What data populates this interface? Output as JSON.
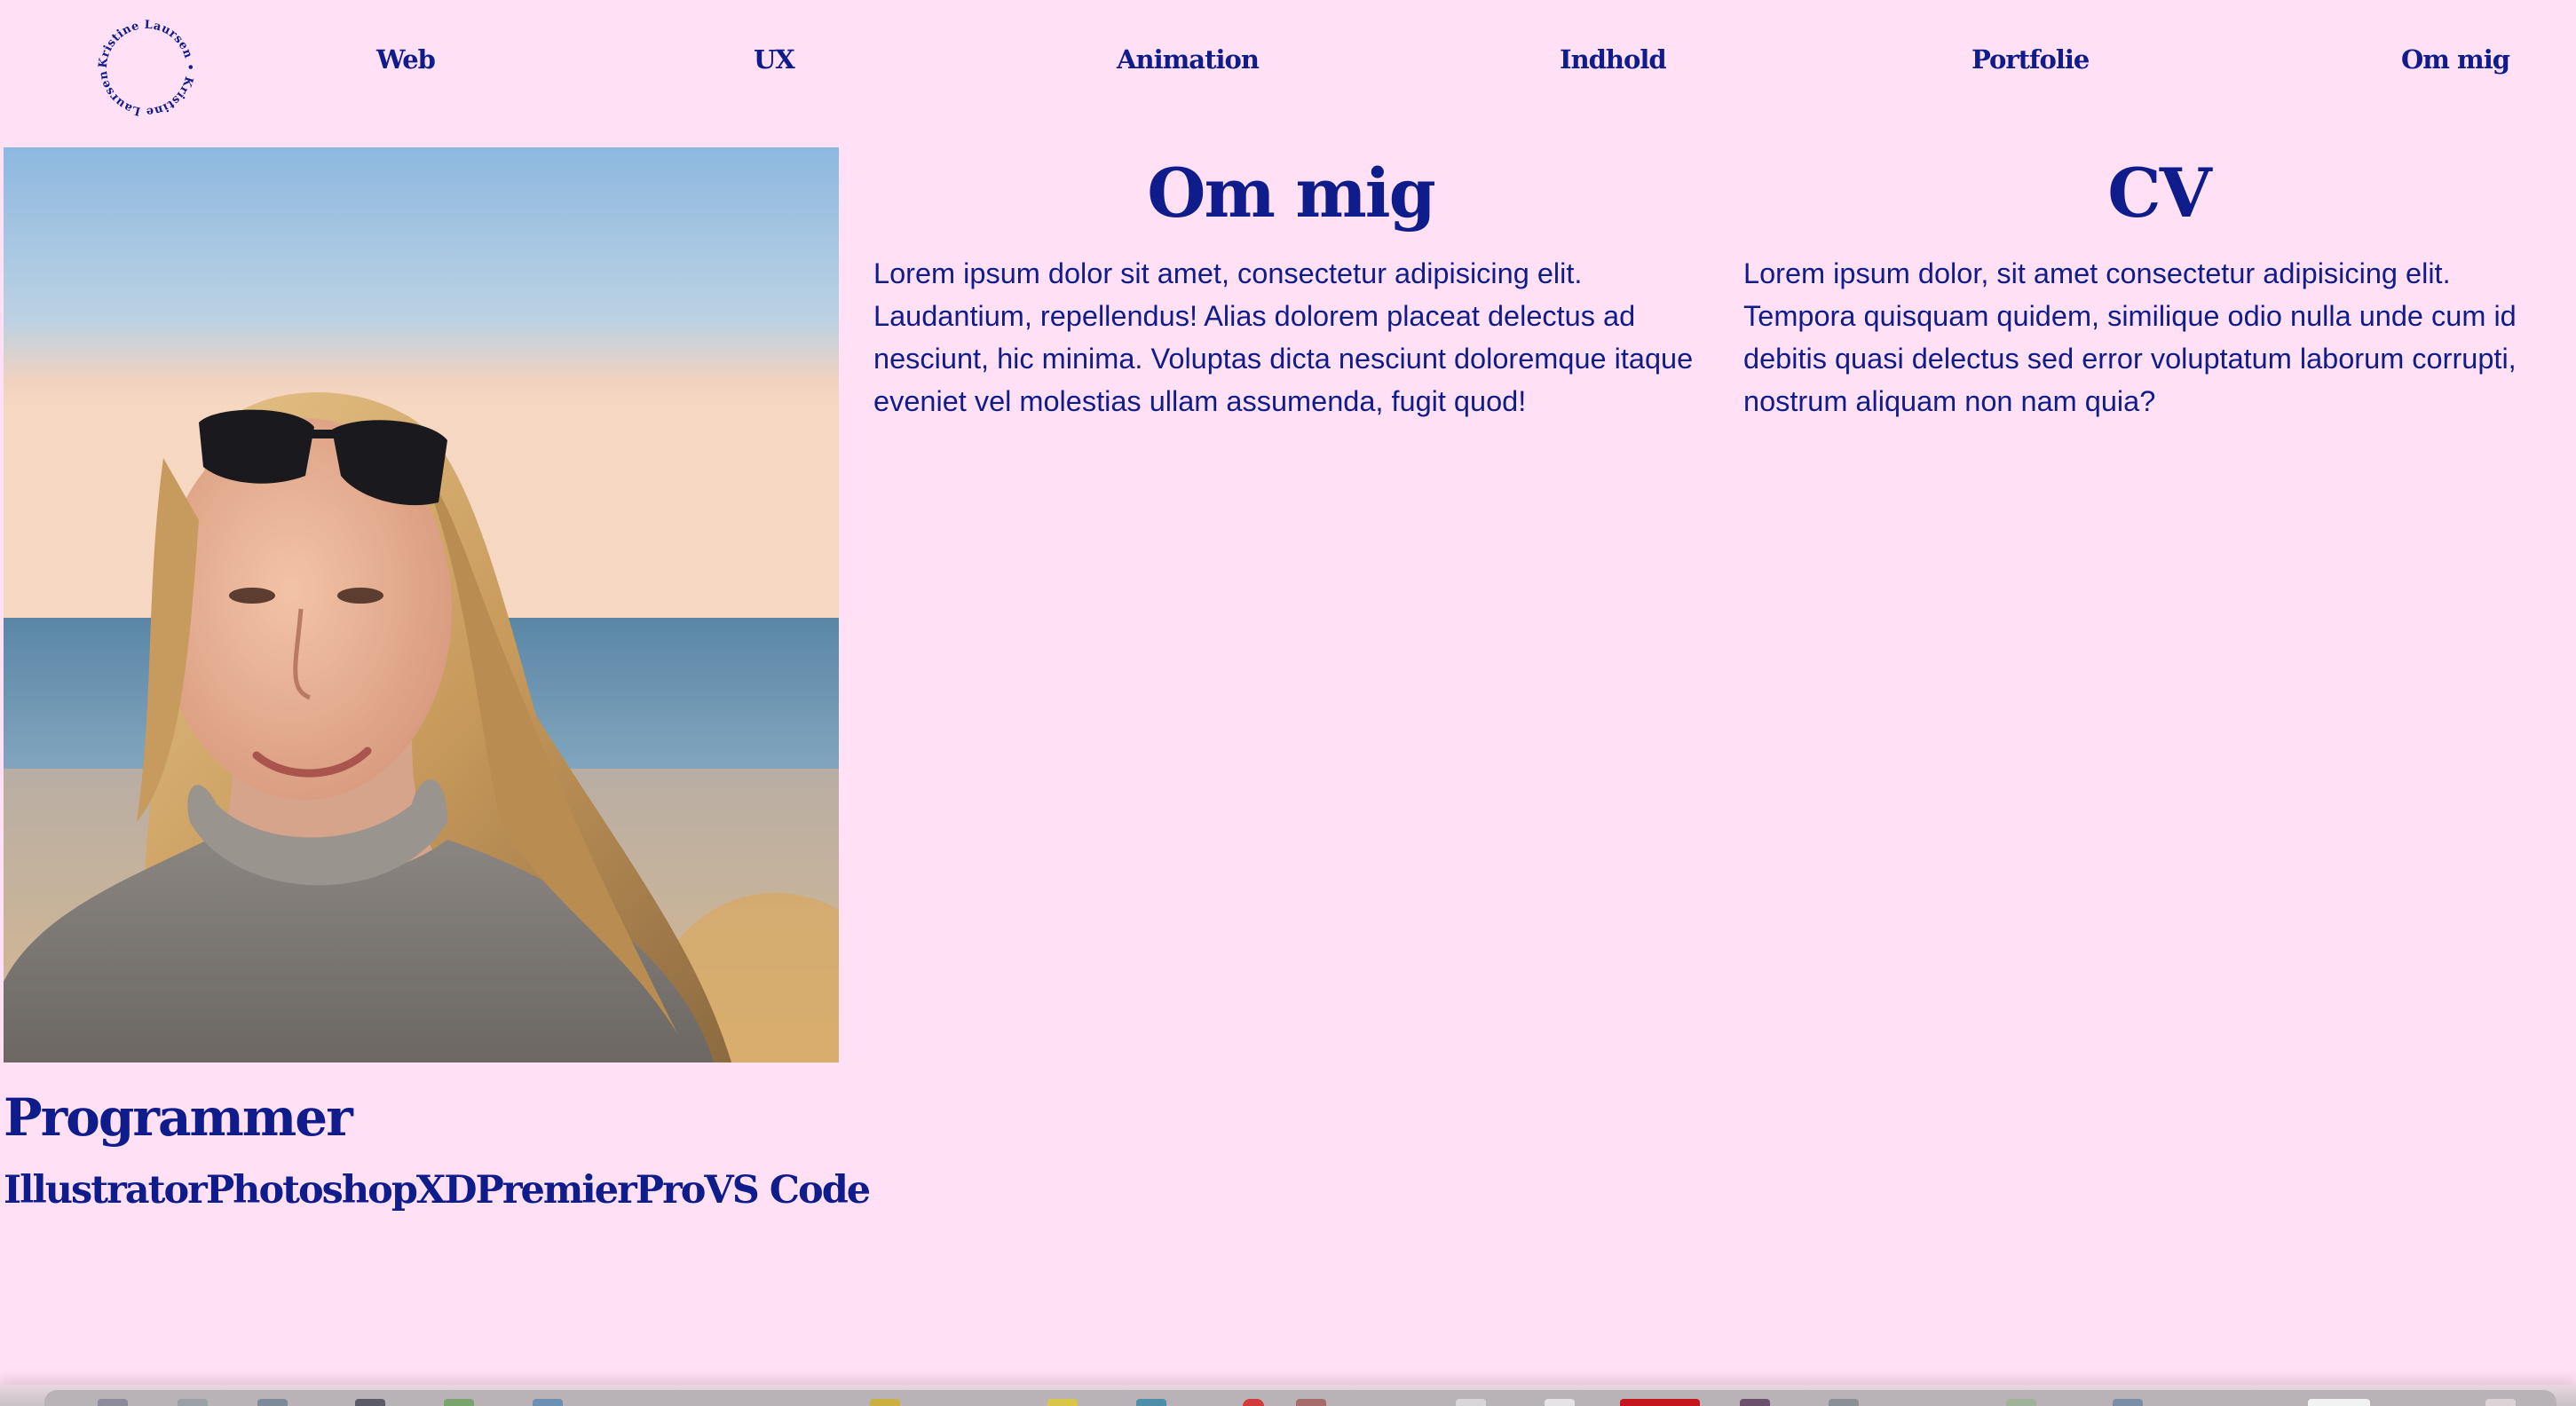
{
  "logo": {
    "ring_text": "Kristine Laursen • Kristine Laursen • ",
    "icon": "circular-text-logo"
  },
  "nav": {
    "items": [
      {
        "label": "Web"
      },
      {
        "label": "UX"
      },
      {
        "label": "Animation"
      },
      {
        "label": "Indhold"
      },
      {
        "label": "Portfolie"
      },
      {
        "label": "Om mig"
      }
    ]
  },
  "about": {
    "title": "Om mig",
    "text": "Lorem ipsum dolor sit amet, consectetur adipisicing elit. Laudantium, repellendus! Alias dolorem placeat delectus ad nesciunt, hic minima. Voluptas dicta nesciunt doloremque itaque eveniet vel molestias ullam assumenda, fugit quod!"
  },
  "cv": {
    "title": "CV",
    "text": "Lorem ipsum dolor, sit amet consectetur adipisicing elit. Tempora quisquam quidem, similique odio nulla unde cum id debitis quasi delectus sed error voluptatum laborum corrupti, nostrum aliquam non nam quia?"
  },
  "programs": {
    "title": "Programmer",
    "items": [
      "Illustrator",
      "Photoshop",
      "XD",
      "Premier",
      "Pro",
      "VS Code"
    ]
  },
  "colors": {
    "background": "#ffe0f4",
    "text": "#0f1c8c"
  }
}
